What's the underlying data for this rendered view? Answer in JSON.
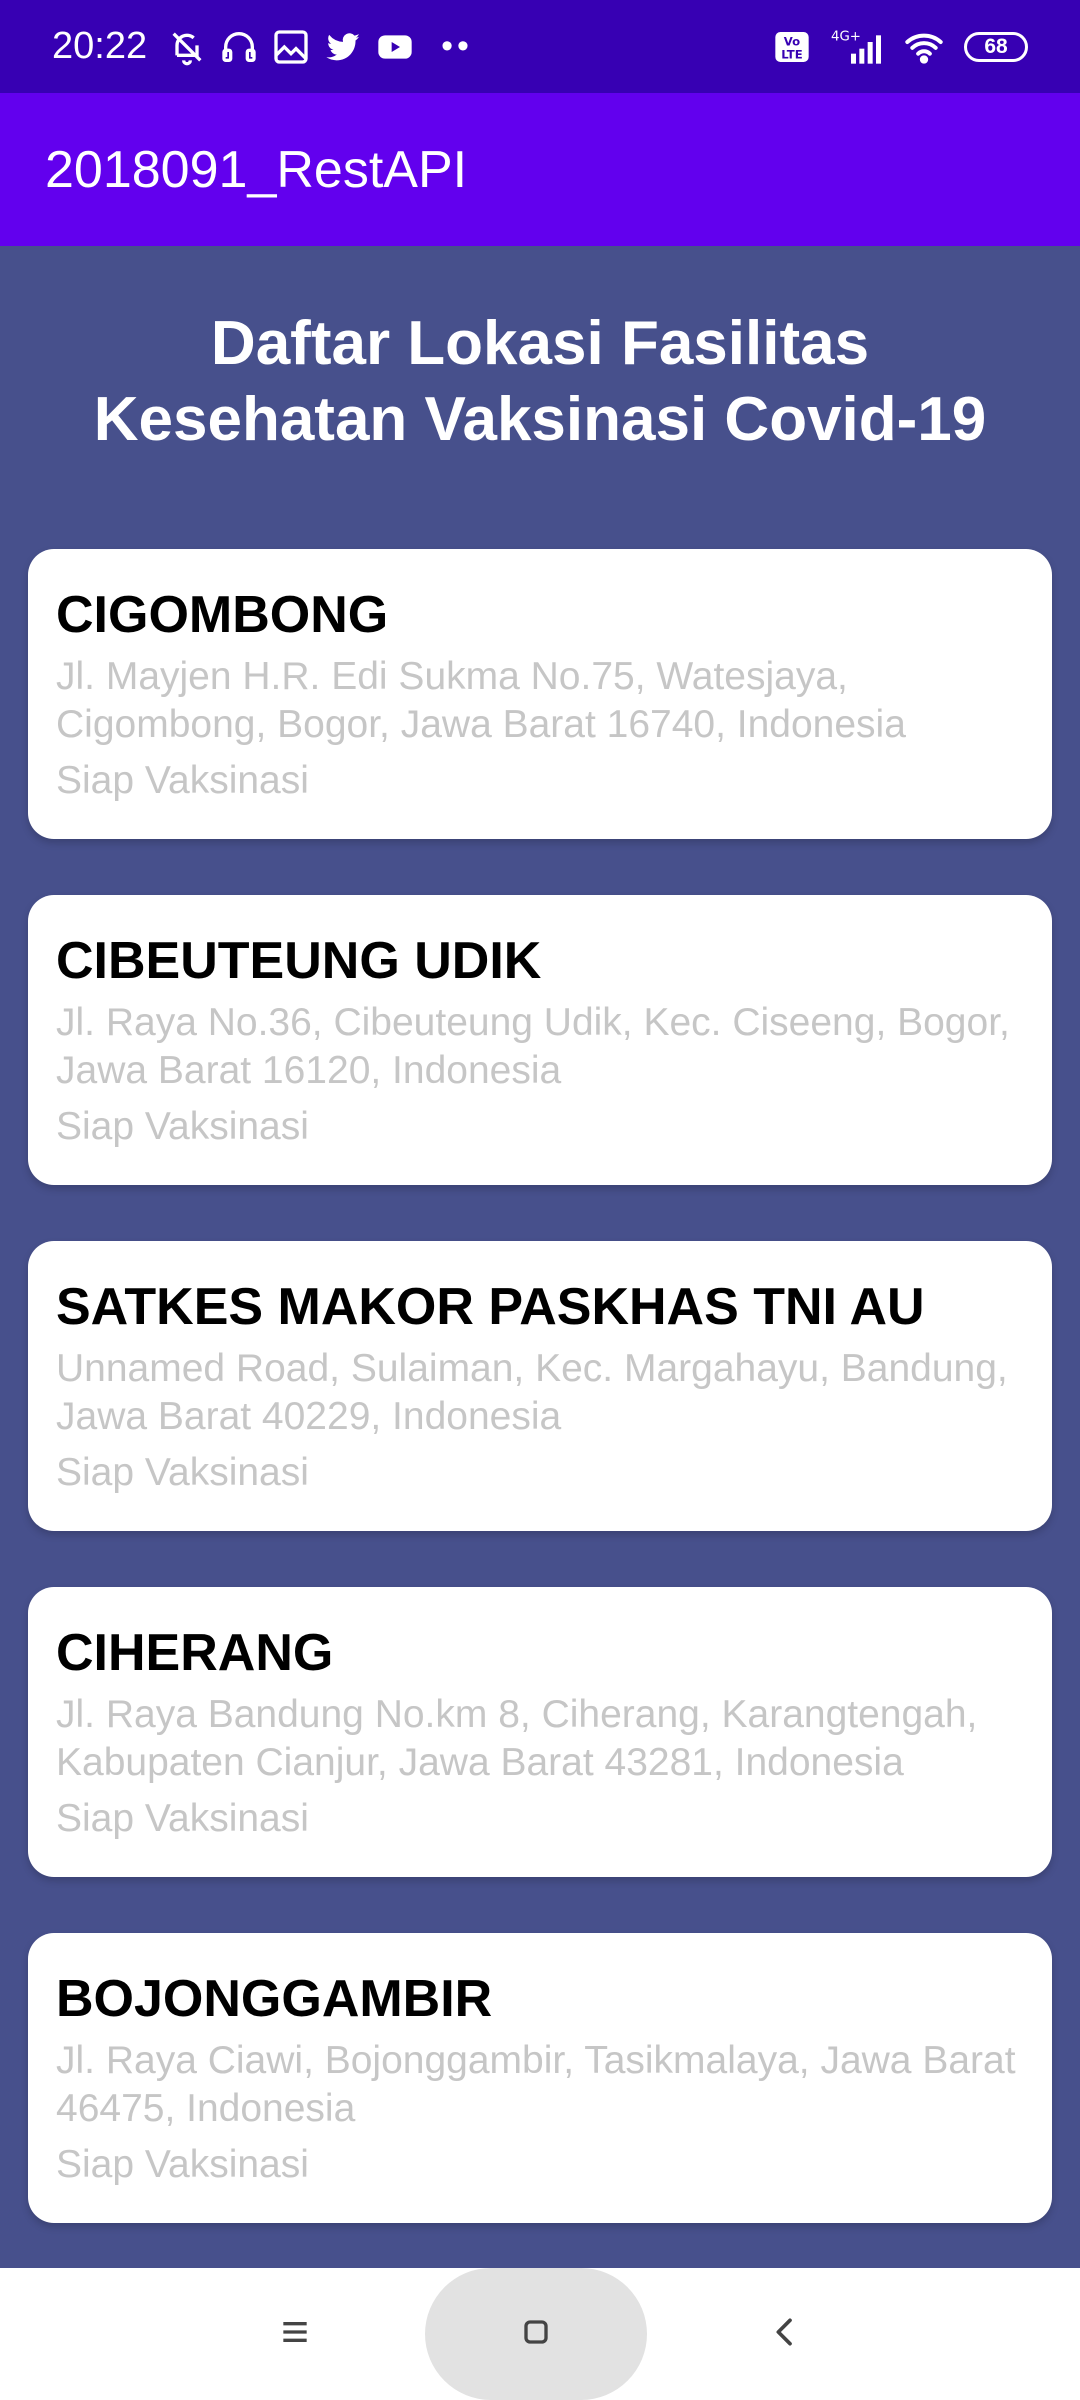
{
  "status_bar": {
    "time": "20:22",
    "icons": [
      "mute-bell-icon",
      "headphones-icon",
      "gallery-icon",
      "twitter-icon",
      "youtube-icon"
    ],
    "overflow": "••",
    "network_label": "4G+",
    "volte_label": "Vo LTE",
    "battery": "68"
  },
  "app_bar": {
    "title": "2018091_RestAPI"
  },
  "page": {
    "title_line1": "Daftar Lokasi Fasilitas",
    "title_line2": "Kesehatan Vaksinasi Covid-19"
  },
  "locations": [
    {
      "name": "CIGOMBONG",
      "address_line1": "Jl. Mayjen H.R. Edi Sukma No.75, Watesjaya,",
      "address_line2": "Cigombong, Bogor, Jawa Barat 16740, Indonesia",
      "status": "Siap Vaksinasi"
    },
    {
      "name": "CIBEUTEUNG UDIK",
      "address_line1": "Jl. Raya No.36, Cibeuteung Udik, Kec. Ciseeng, Bogor,",
      "address_line2": "Jawa Barat 16120, Indonesia",
      "status": "Siap Vaksinasi"
    },
    {
      "name": "SATKES MAKOR PASKHAS TNI AU",
      "address_line1": "Unnamed Road, Sulaiman, Kec. Margahayu, Bandung,",
      "address_line2": "Jawa Barat 40229, Indonesia",
      "status": "Siap Vaksinasi"
    },
    {
      "name": "CIHERANG",
      "address_line1": "Jl. Raya Bandung No.km 8, Ciherang, Karangtengah,",
      "address_line2": "Kabupaten Cianjur, Jawa Barat 43281, Indonesia",
      "status": "Siap Vaksinasi"
    },
    {
      "name": "BOJONGGAMBIR",
      "address_line1": "Jl. Raya Ciawi, Bojonggambir, Tasikmalaya, Jawa Barat",
      "address_line2": "46475, Indonesia",
      "status": "Siap Vaksinasi"
    }
  ],
  "colors": {
    "status_bar": "#3700b3",
    "app_bar": "#6200ee",
    "background": "#47508c",
    "card": "#ffffff",
    "secondary_text": "#c6c6c6"
  },
  "nav_bar": {
    "icons": [
      "menu-icon",
      "home-icon",
      "back-icon"
    ]
  }
}
